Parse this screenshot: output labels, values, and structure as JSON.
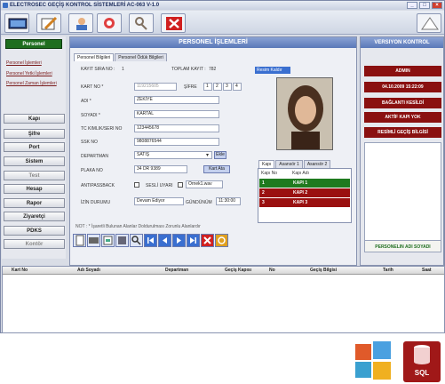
{
  "window": {
    "title": "ELECTROSEC GEÇİŞ KONTROL SİSTEMLERİ AC-063 V-1.0"
  },
  "menu": {
    "personel": "Personel",
    "links": [
      "Personel İşlemleri",
      "Personel Yetki İşlemleri",
      "Personel Zaman İşlemleri"
    ],
    "items": [
      "Kapı",
      "Şifre",
      "Port",
      "Sistem",
      "Test",
      "Hesap",
      "Rapor",
      "Ziyaretçi",
      "PDKS",
      "Kontör"
    ]
  },
  "panel": {
    "title": "PERSONEL İŞLEMLERİ",
    "tabs": [
      "Personel Bilgileri",
      "Personel Ödük Bilgileri"
    ]
  },
  "form": {
    "kart_sira_label": "KAYIT SIRA NO :",
    "kart_sira": "1",
    "toplam_label": "TOPLAM KAYIT :",
    "toplam": "782",
    "kart_no_label": "KART NO *",
    "kart_no": "119215605",
    "sifre_label": "ŞİFRE",
    "sifre": [
      "1",
      "2",
      "3",
      "4"
    ],
    "adi_label": "ADI *",
    "adi": "ZEKİYE",
    "soyadi_label": "SOYADI *",
    "soyadi": "KARTAL",
    "tc_label": "TC KIMLIK/SERI NO",
    "tc": "123445678",
    "ssk_label": "SSK NO",
    "ssk": "9808876544",
    "departman_label": "DEPARTMAN",
    "departman": "SATIŞ",
    "ekle": "Ekle",
    "plaka_label": "PLAKA NO",
    "plaka": "34 DR 9389",
    "kart_ata": "Kart Ata",
    "anti_label": "ANTIPASSBACK",
    "sesli_label": "SESLİ UYARI",
    "ses_dosya": "Ornek1.wav",
    "izin_label": "İZİN DURUMU",
    "izin": "Devam Ediyor",
    "gunduz_label": "GÜNDÜNÜM",
    "gunduz": "11:30:00",
    "note": "NOT :  *  İşaretli Bulunan Alanlar Doldurulması Zorunlu Alanlardır"
  },
  "photo": {
    "header": "Resim Kaldır"
  },
  "gates": {
    "tabs": [
      "Kapı",
      "Asansör 1",
      "Asansör 2"
    ],
    "cols": [
      "Kapı No",
      "Kapı Adı"
    ],
    "rows": [
      {
        "no": "1",
        "name": "KAPI 1",
        "color": "#1f7a1f"
      },
      {
        "no": "2",
        "name": "KAPI 2",
        "color": "#9a1010"
      },
      {
        "no": "3",
        "name": "KAPI 3",
        "color": "#9a1010"
      }
    ]
  },
  "right": {
    "title": "VERSIYON KONTROL",
    "buttons": [
      "ADMIN",
      "04.10.2009 15:22:09",
      "BAĞLANTI KESİLDİ",
      "AKTİF KAPI YOK",
      "RESİMLİ GEÇİŞ BİLGİSİ"
    ],
    "footer": "PERSONELIN ADI SOYADI"
  },
  "table": {
    "cols": [
      "Kart No",
      "Adı Soyadı",
      "Departman",
      "Geçiş Kapısı",
      "No",
      "Geçiş Bilgisi",
      "Tarih",
      "Saat"
    ]
  },
  "logos": {
    "sql": "SQL"
  },
  "colors": {
    "accent": "#5a78b8",
    "green": "#1f6e1f",
    "red": "#9a1010"
  }
}
